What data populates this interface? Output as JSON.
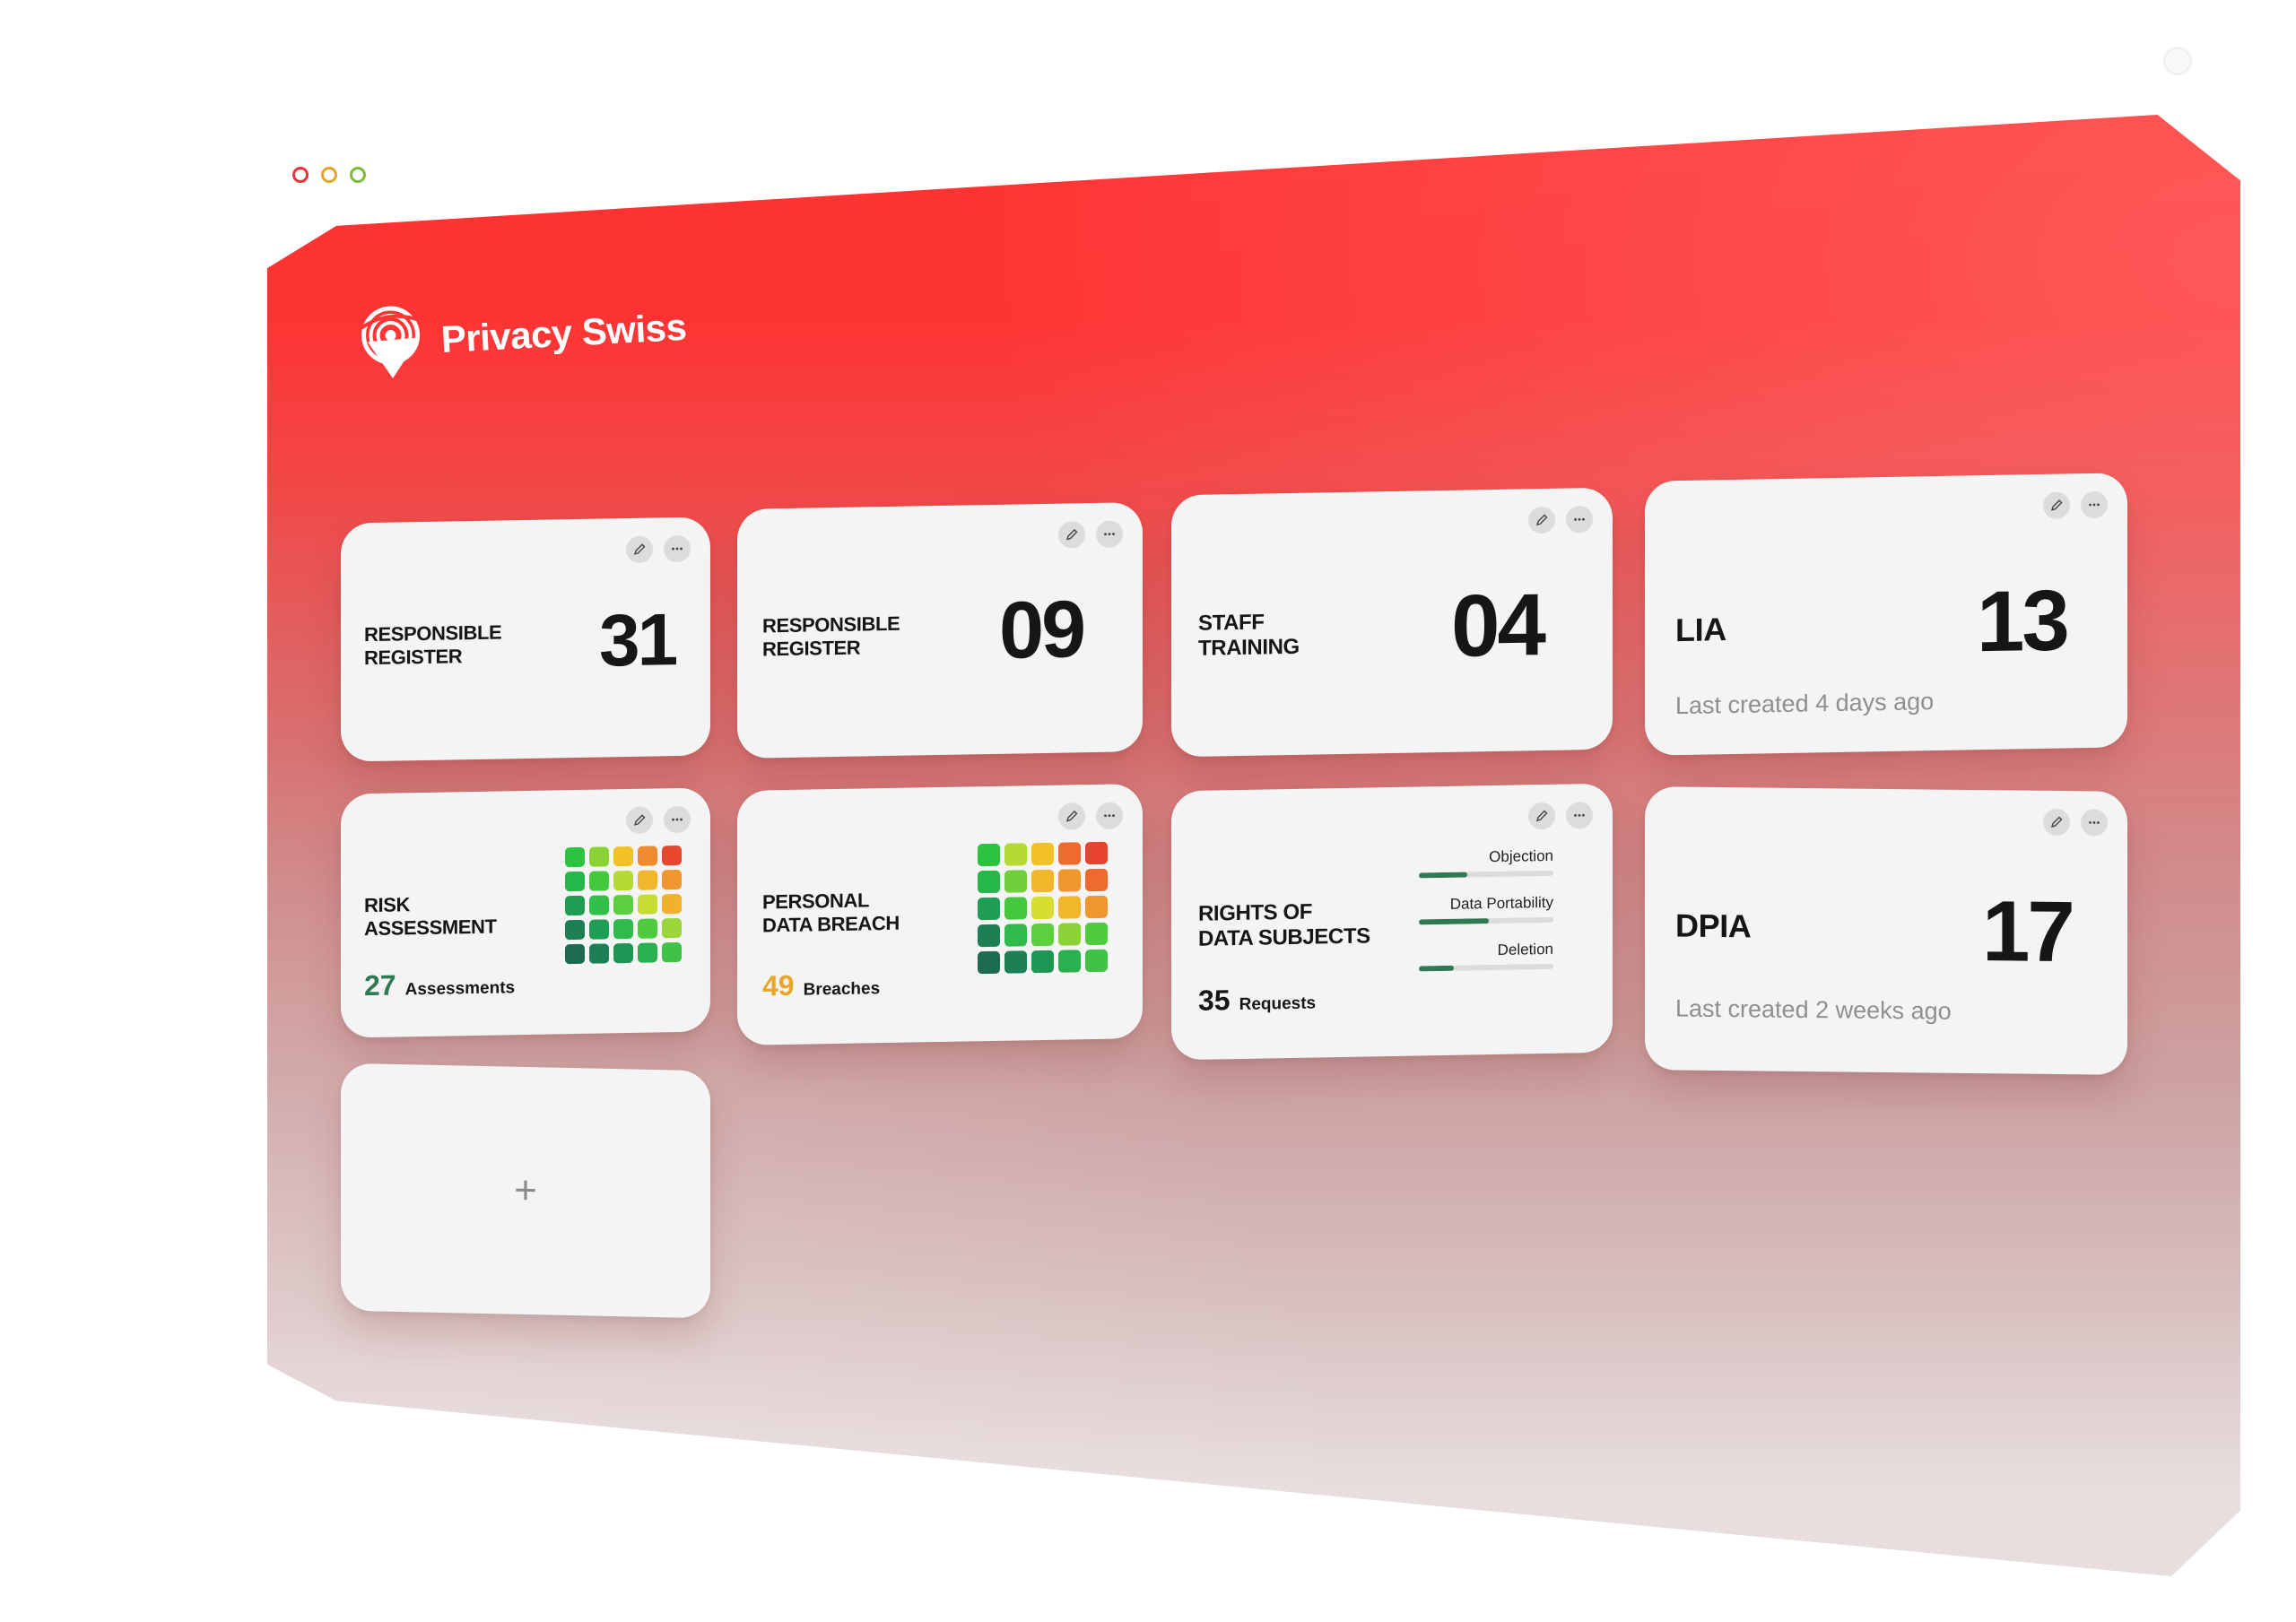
{
  "brand": {
    "name": "Privacy Swiss"
  },
  "colors": {
    "accent_red": "#ff3535",
    "card_bg": "#f4f4f4",
    "number_green": "#2f7a52",
    "number_amber": "#e7a72b"
  },
  "cards": {
    "responsible_register_1": {
      "title": "RESPONSIBLE\nREGISTER",
      "value": "31"
    },
    "responsible_register_2": {
      "title": "RESPONSIBLE\nREGISTER",
      "value": "09"
    },
    "staff_training": {
      "title": "STAFF\nTRAINING",
      "value": "04"
    },
    "lia": {
      "title": "LIA",
      "value": "13",
      "subtitle": "Last created 4 days ago"
    },
    "risk_assessment": {
      "title": "RISK\nASSESSMENT",
      "count": "27",
      "count_label": "Assessments"
    },
    "personal_data_breach": {
      "title": "PERSONAL\nDATA BREACH",
      "count": "49",
      "count_label": "Breaches"
    },
    "rights_of_data_subjects": {
      "title": "RIGHTS OF\nDATA SUBJECTS",
      "count": "35",
      "count_label": "Requests",
      "bars": [
        {
          "label": "Objection",
          "fill": 0.36
        },
        {
          "label": "Data Portability",
          "fill": 0.52
        },
        {
          "label": "Deletion",
          "fill": 0.26
        }
      ]
    },
    "dpia": {
      "title": "DPIA",
      "value": "17",
      "subtitle": "Last created 2 weeks ago"
    },
    "add": {
      "symbol": "+"
    }
  },
  "icons": {
    "edit": "pencil-icon",
    "more": "more-dots-icon",
    "add": "plus-icon",
    "logo": "fingerprint-shield-icon"
  }
}
